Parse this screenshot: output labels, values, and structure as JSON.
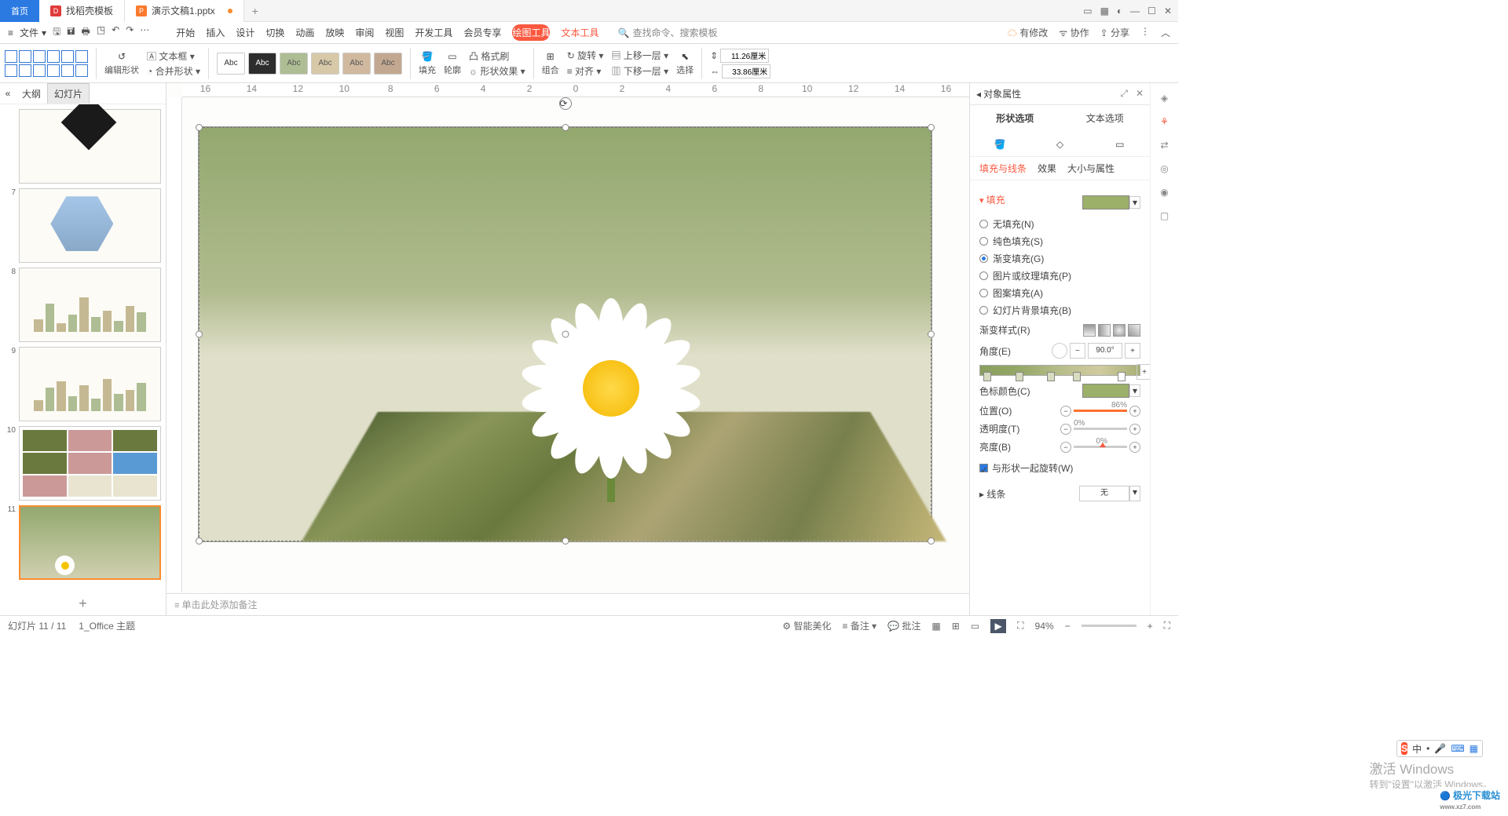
{
  "tabs": {
    "home": "首页",
    "templates": "找稻壳模板",
    "doc": "演示文稿1.pptx"
  },
  "menu": {
    "file": "文件"
  },
  "maintabs": {
    "start": "开始",
    "insert": "插入",
    "design": "设计",
    "trans": "切换",
    "anim": "动画",
    "play": "放映",
    "review": "审阅",
    "view": "视图",
    "dev": "开发工具",
    "member": "会员专享",
    "draw": "绘图工具",
    "text": "文本工具"
  },
  "search": {
    "placeholder": "查找命令、搜索模板"
  },
  "topright": {
    "changes": "有修改",
    "coop": "协作",
    "share": "分享"
  },
  "ribbon": {
    "editshape": "编辑形状",
    "textbox": "文本框",
    "merge": "合并形状",
    "abc": "Abc",
    "fill": "填充",
    "outline": "轮廓",
    "fx": "形状效果",
    "fmt": "格式刷",
    "group": "组合",
    "rotate": "旋转",
    "align": "对齐",
    "movef": "上移一层",
    "moveb": "下移一层",
    "select": "选择",
    "w": "11.26厘米",
    "h": "33.86厘米"
  },
  "leftpane": {
    "outline": "大纲",
    "slides": "幻灯片"
  },
  "thumbs": {
    "n7": "7",
    "n8": "8",
    "n9": "9",
    "n10": "10",
    "n11": "11"
  },
  "notes": {
    "placeholder": "单击此处添加备注"
  },
  "rpanel": {
    "title": "对象属性",
    "tab_shape": "形状选项",
    "tab_text": "文本选项",
    "sub_fill": "填充与线条",
    "sub_fx": "效果",
    "sub_size": "大小与属性",
    "sect_fill": "填充",
    "r_none": "无填充(N)",
    "r_solid": "纯色填充(S)",
    "r_grad": "渐变填充(G)",
    "r_pic": "图片或纹理填充(P)",
    "r_patt": "图案填充(A)",
    "r_bg": "幻灯片背景填充(B)",
    "gradstyle": "渐变样式(R)",
    "angle": "角度(E)",
    "angle_v": "90.0°",
    "stopcolor": "色标颜色(C)",
    "pos": "位置(O)",
    "pos_v": "86%",
    "trans": "透明度(T)",
    "trans_v": "0%",
    "bright": "亮度(B)",
    "bright_v": "0%",
    "rotate_with": "与形状一起旋转(W)",
    "sect_line": "线条",
    "line_none": "无"
  },
  "status": {
    "slideno": "幻灯片 11 / 11",
    "theme": "1_Office 主题",
    "beautify": "智能美化",
    "notes": "备注",
    "annot": "批注",
    "zoom": "94%"
  },
  "watermark": {
    "l1": "激活 Windows",
    "l2": "转到\"设置\"以激活 Windows。"
  },
  "brand": "极光下载站",
  "ime": {
    "zh": "中"
  }
}
